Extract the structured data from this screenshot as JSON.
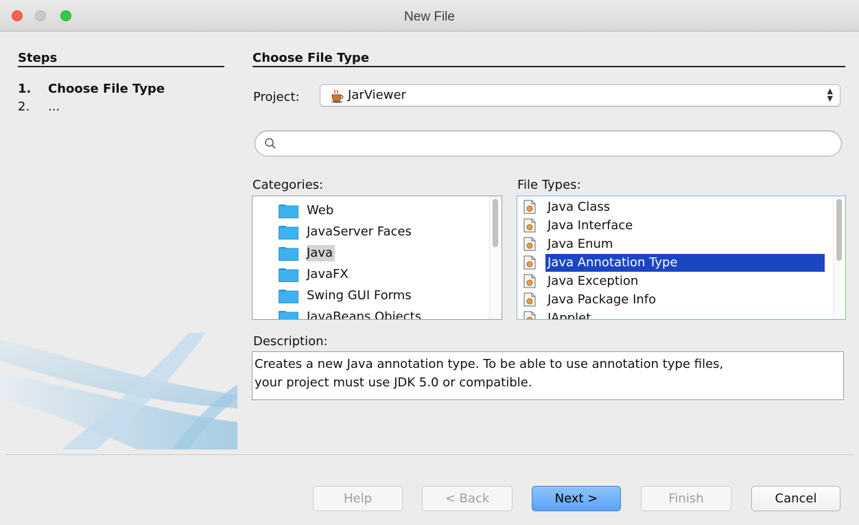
{
  "window": {
    "title": "New File"
  },
  "steps": {
    "heading": "Steps",
    "items": [
      {
        "num": "1.",
        "label": "Choose File Type"
      },
      {
        "num": "2.",
        "label": "..."
      }
    ]
  },
  "main": {
    "heading": "Choose File Type",
    "project_label": "Project:",
    "project_value": "JarViewer",
    "search_placeholder": "",
    "categories_label": "Categories:",
    "categories": [
      "Web",
      "JavaServer Faces",
      "Java",
      "JavaFX",
      "Swing GUI Forms",
      "JavaBeans Objects"
    ],
    "selected_category": "Java",
    "file_types_label": "File Types:",
    "file_types": [
      "Java Class",
      "Java Interface",
      "Java Enum",
      "Java Annotation Type",
      "Java Exception",
      "Java Package Info",
      "JApplet"
    ],
    "selected_file_type": "Java Annotation Type",
    "description_label": "Description:",
    "description_line1": "Creates a new Java annotation type. To be able to use annotation type files,",
    "description_line2": "your project must use JDK 5.0 or compatible."
  },
  "buttons": {
    "help": "Help",
    "back": "< Back",
    "next": "Next >",
    "finish": "Finish",
    "cancel": "Cancel"
  },
  "colors": {
    "selection_blue": "#1a46c2",
    "folder_blue": "#3ab3f0",
    "default_button": "#6ab0f7"
  }
}
